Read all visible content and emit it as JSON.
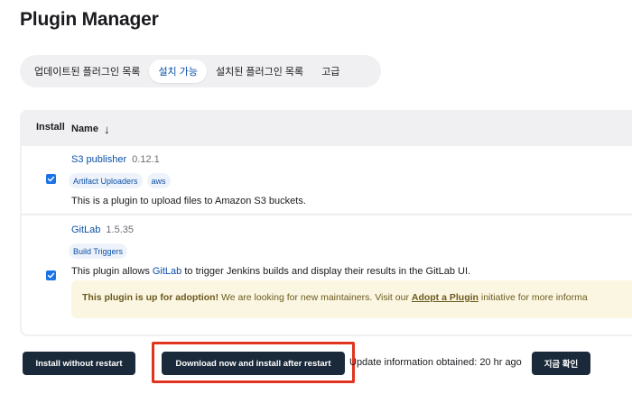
{
  "page": {
    "title": "Plugin Manager"
  },
  "tabs": [
    {
      "label": "업데이트된 플러그인 목록",
      "active": false
    },
    {
      "label": "설치 가능",
      "active": true
    },
    {
      "label": "설치된 플러그인 목록",
      "active": false
    },
    {
      "label": "고급",
      "active": false
    }
  ],
  "table": {
    "headers": {
      "install": "Install",
      "name": "Name",
      "sort_icon": "arrow-down-icon",
      "sort_glyph": "↓"
    },
    "rows": [
      {
        "checked": true,
        "name": "S3 publisher",
        "version": "0.12.1",
        "tags": [
          "Artifact Uploaders",
          "aws"
        ],
        "description": "This is a plugin to upload files to Amazon S3 buckets."
      },
      {
        "checked": true,
        "name": "GitLab",
        "version": "1.5.35",
        "tags": [
          "Build Triggers"
        ],
        "description_prefix": "This plugin allows ",
        "description_link": "GitLab",
        "description_suffix": " to trigger Jenkins builds and display their results in the GitLab UI.",
        "adoption": {
          "strong": "This plugin is up for adoption!",
          "text": " We are looking for new maintainers. Visit our ",
          "link": "Adopt a Plugin",
          "suffix": " initiative for more informa"
        }
      }
    ]
  },
  "footer": {
    "install_without_restart": "Install without restart",
    "install_after_restart": "Download now and install after restart",
    "update_info": "Update information obtained: 20 hr ago",
    "check_now": "지금 확인"
  },
  "colors": {
    "accent": "#0b4fa5",
    "button_dark": "#1b2a3a",
    "highlight": "#e0341f",
    "adoption_bg": "#fbf6e2",
    "checkbox": "#1a73e8"
  }
}
